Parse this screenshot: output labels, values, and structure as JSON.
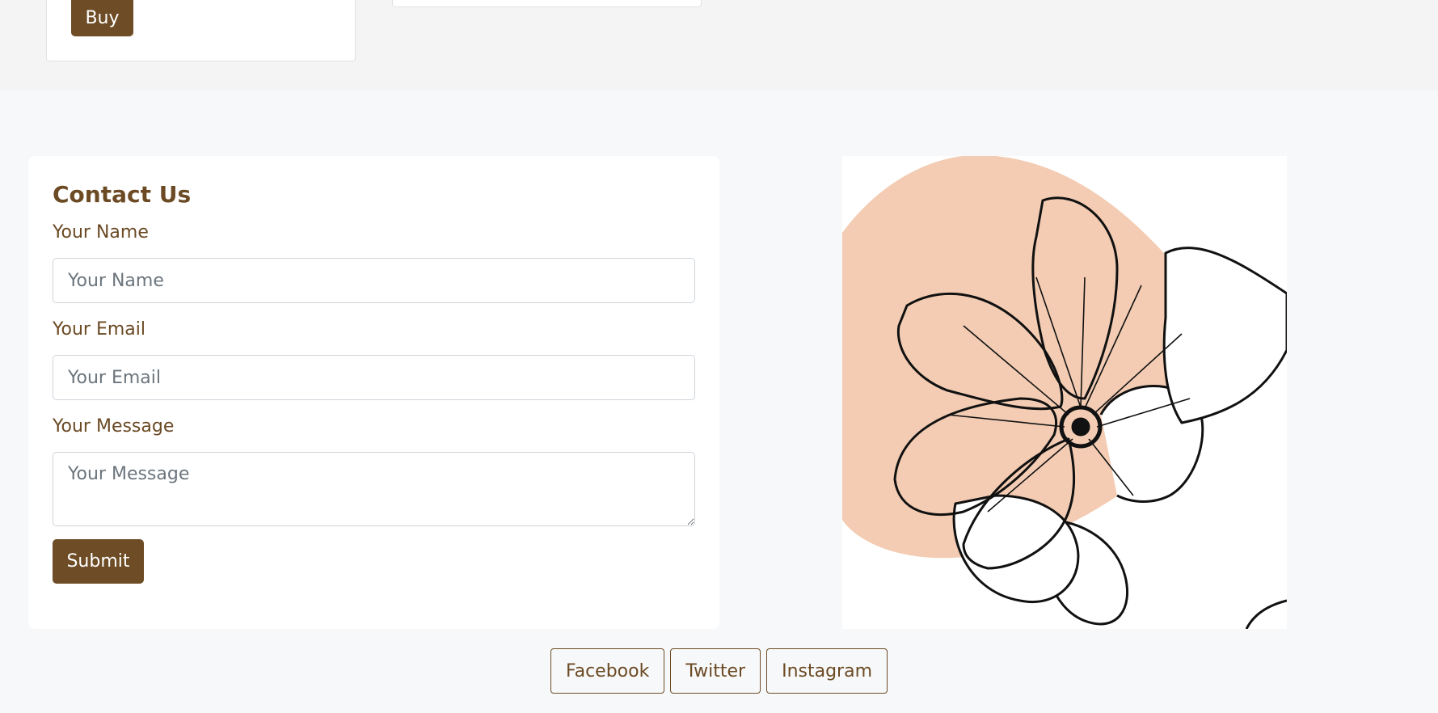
{
  "products": {
    "buy_label": "Buy"
  },
  "contact": {
    "title": "Contact Us",
    "name_label": "Your Name",
    "name_placeholder": "Your Name",
    "name_value": "",
    "email_label": "Your Email",
    "email_placeholder": "Your Email",
    "email_value": "",
    "message_label": "Your Message",
    "message_placeholder": "Your Message",
    "message_value": "",
    "submit_label": "Submit"
  },
  "image": {
    "subject": "flower-illustration",
    "blob_color": "#f3ccb3",
    "line_color": "#111111"
  },
  "social": {
    "facebook_label": "Facebook",
    "twitter_label": "Twitter",
    "instagram_label": "Instagram"
  },
  "theme": {
    "accent": "#6e4c25",
    "page_bg": "#f7f8f9",
    "band_bg": "#f4f4f4"
  }
}
